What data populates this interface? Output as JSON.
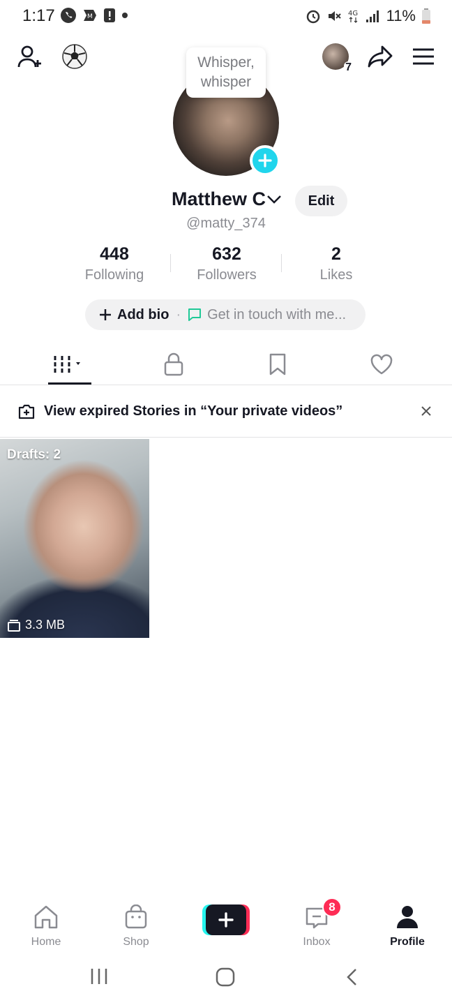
{
  "status_bar": {
    "time": "1:17",
    "battery": "11%"
  },
  "bubble": {
    "line1": "Whisper,",
    "line2": "whisper"
  },
  "profile": {
    "name": "Matthew C",
    "edit_label": "Edit",
    "handle": "@matty_374",
    "stats": [
      {
        "value": "448",
        "label": "Following"
      },
      {
        "value": "632",
        "label": "Followers"
      },
      {
        "value": "2",
        "label": "Likes"
      }
    ],
    "add_bio": "Add bio",
    "separator": "·",
    "contact_placeholder": "Get in touch with me..."
  },
  "header": {
    "friends_badge": "7"
  },
  "banner": {
    "text": "View expired Stories in “Your private videos”"
  },
  "drafts": {
    "label": "Drafts: 2",
    "size": "3.3 MB"
  },
  "bottom_nav": {
    "home": "Home",
    "shop": "Shop",
    "inbox": "Inbox",
    "inbox_badge": "8",
    "profile": "Profile"
  },
  "colors": {
    "accent_cyan": "#20d5ec",
    "brand_pink": "#fe2c55",
    "text_dark": "#161823",
    "text_muted": "#8a8b91"
  },
  "icons": [
    "add-user-icon",
    "soccer-ball-icon",
    "share-icon",
    "menu-icon",
    "plus-icon",
    "chevron-down-icon",
    "grid-icon",
    "lock-icon",
    "bookmark-icon",
    "heart-icon",
    "story-icon",
    "close-icon",
    "draft-icon",
    "home-icon",
    "shop-icon",
    "inbox-icon",
    "profile-icon"
  ]
}
